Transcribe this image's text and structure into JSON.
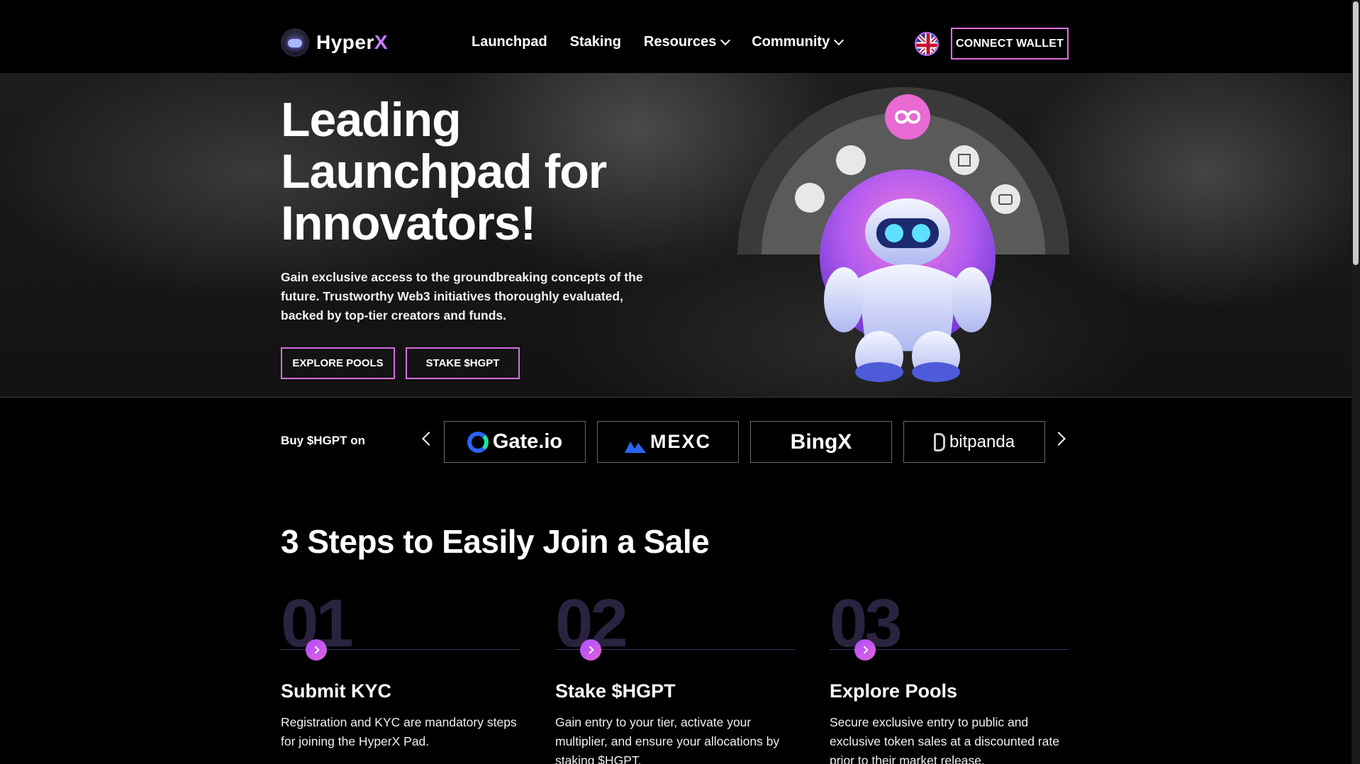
{
  "header": {
    "logo_text": "Hyper",
    "logo_accent": "X",
    "nav": [
      {
        "label": "Launchpad",
        "has_dropdown": false
      },
      {
        "label": "Staking",
        "has_dropdown": false
      },
      {
        "label": "Resources",
        "has_dropdown": true
      },
      {
        "label": "Community",
        "has_dropdown": true
      }
    ],
    "language_icon": "uk-flag-icon",
    "connect_label": "CONNECT WALLET"
  },
  "hero": {
    "title": "Leading Launchpad for Innovators!",
    "description": "Gain exclusive access to the groundbreaking concepts of the future. Trustworthy Web3 initiatives thoroughly evaluated, backed by top-tier creators and funds.",
    "explore_label": "EXPLORE POOLS",
    "stake_label": "STAKE $HGPT"
  },
  "exchanges": {
    "label": "Buy $HGPT on",
    "items": [
      {
        "name": "Gate.io",
        "icon": "gate-icon"
      },
      {
        "name": "MEXC",
        "icon": "mexc-icon"
      },
      {
        "name": "BingX",
        "icon": ""
      },
      {
        "name": "bitpanda",
        "icon": "bitpanda-icon"
      }
    ]
  },
  "steps": {
    "title": "3 Steps to Easily Join a Sale",
    "items": [
      {
        "number": "01",
        "title": "Submit KYC",
        "description": "Registration and KYC are mandatory steps for joining the HyperX Pad."
      },
      {
        "number": "02",
        "title": "Stake $HGPT",
        "description": "Gain entry to your tier, activate your multiplier, and ensure your allocations by staking $HGPT."
      },
      {
        "number": "03",
        "title": "Explore Pools",
        "description": "Secure exclusive entry to public and exclusive token sales at a discounted rate prior to their market release."
      }
    ]
  },
  "colors": {
    "accent": "#d76ce0",
    "accent_purple": "#b04dff",
    "background": "#000000"
  }
}
